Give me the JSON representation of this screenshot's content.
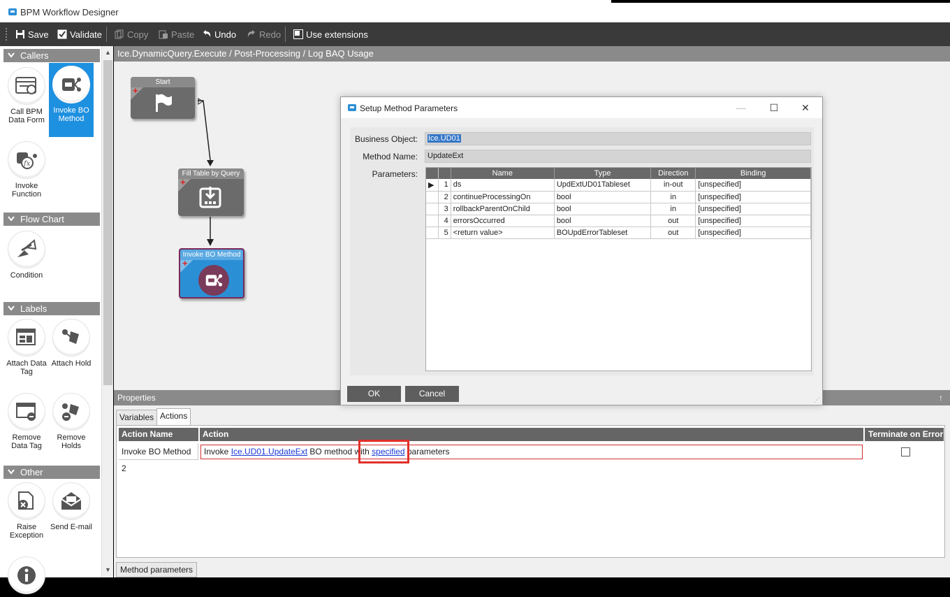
{
  "window": {
    "title": "BPM Workflow Designer"
  },
  "toolbar": {
    "save": "Save",
    "validate": "Validate",
    "copy": "Copy",
    "paste": "Paste",
    "undo": "Undo",
    "redo": "Redo",
    "use_extensions": "Use extensions"
  },
  "toolbox": {
    "sections": {
      "callers": "Callers",
      "flow_chart": "Flow Chart",
      "labels": "Labels",
      "other": "Other"
    },
    "tools": {
      "call_bpm": "Call BPM Data Form",
      "invoke_bo": "Invoke BO Method",
      "invoke_function": "Invoke Function",
      "condition": "Condition",
      "attach_data_tag": "Attach Data Tag",
      "attach_hold": "Attach Hold",
      "remove_data_tag": "Remove Data Tag",
      "remove_holds": "Remove Holds",
      "raise_exception": "Raise Exception",
      "send_email": "Send E-mail"
    }
  },
  "canvas": {
    "breadcrumb": "Ice.DynamicQuery.Execute / Post-Processing / Log BAQ Usage",
    "nodes": {
      "start": "Start",
      "fill_table": "Fill Table by Query",
      "invoke_bo": "Invoke BO Method"
    }
  },
  "dialog": {
    "title": "Setup Method Parameters",
    "business_object_label": "Business Object:",
    "business_object_value": "Ice.UD01",
    "method_name_label": "Method Name:",
    "method_name_value": "UpdateExt",
    "parameters_label": "Parameters:",
    "columns": {
      "name": "Name",
      "type": "Type",
      "direction": "Direction",
      "binding": "Binding"
    },
    "rows": [
      {
        "num": "1",
        "name": "ds",
        "type": "UpdExtUD01Tableset",
        "direction": "in-out",
        "binding": "[unspecified]"
      },
      {
        "num": "2",
        "name": "continueProcessingOn",
        "type": "bool",
        "direction": "in",
        "binding": "[unspecified]"
      },
      {
        "num": "3",
        "name": "rollbackParentOnChild",
        "type": "bool",
        "direction": "in",
        "binding": "[unspecified]"
      },
      {
        "num": "4",
        "name": "errorsOccurred",
        "type": "bool",
        "direction": "out",
        "binding": "[unspecified]"
      },
      {
        "num": "5",
        "name": "<return value>",
        "type": "BOUpdErrorTableset",
        "direction": "out",
        "binding": "[unspecified]"
      }
    ],
    "ok": "OK",
    "cancel": "Cancel"
  },
  "properties": {
    "header": "Properties",
    "pin": "↑",
    "tabs": {
      "variables": "Variables",
      "actions": "Actions"
    },
    "columns": {
      "action_name": "Action Name",
      "action": "Action",
      "terminate": "Terminate on Error"
    },
    "row": {
      "action_name": "Invoke BO Method 2",
      "action_prefix": "Invoke ",
      "action_link1": "Ice.UD01.UpdateExt",
      "action_mid": " BO method with ",
      "action_link2": "specified",
      "action_suffix": " parameters"
    },
    "bottom_tab": "Method parameters"
  },
  "colors": {
    "accent": "#1e90e0",
    "toolbar_bg": "#3a3a3a",
    "highlight_box": "#e0302a"
  }
}
